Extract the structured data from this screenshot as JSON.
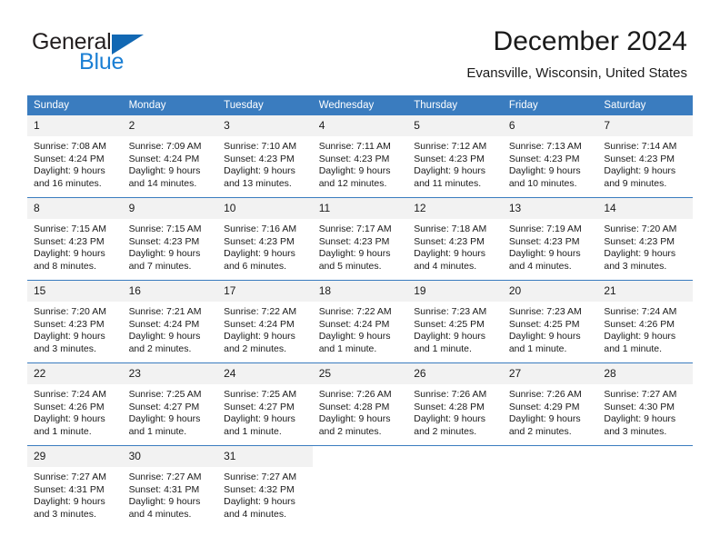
{
  "brand": {
    "logo_text_top": "General",
    "logo_text_bottom": "Blue",
    "logo_triangle_icon": "triangle-icon",
    "accent_color": "#3a7cbf",
    "logo_blue": "#1b7fd4"
  },
  "header": {
    "title": "December 2024",
    "subtitle": "Evansville, Wisconsin, United States"
  },
  "weekday_headers": [
    "Sunday",
    "Monday",
    "Tuesday",
    "Wednesday",
    "Thursday",
    "Friday",
    "Saturday"
  ],
  "weeks": [
    [
      {
        "day": "1",
        "sunrise": "Sunrise: 7:08 AM",
        "sunset": "Sunset: 4:24 PM",
        "daylight_1": "Daylight: 9 hours",
        "daylight_2": "and 16 minutes."
      },
      {
        "day": "2",
        "sunrise": "Sunrise: 7:09 AM",
        "sunset": "Sunset: 4:24 PM",
        "daylight_1": "Daylight: 9 hours",
        "daylight_2": "and 14 minutes."
      },
      {
        "day": "3",
        "sunrise": "Sunrise: 7:10 AM",
        "sunset": "Sunset: 4:23 PM",
        "daylight_1": "Daylight: 9 hours",
        "daylight_2": "and 13 minutes."
      },
      {
        "day": "4",
        "sunrise": "Sunrise: 7:11 AM",
        "sunset": "Sunset: 4:23 PM",
        "daylight_1": "Daylight: 9 hours",
        "daylight_2": "and 12 minutes."
      },
      {
        "day": "5",
        "sunrise": "Sunrise: 7:12 AM",
        "sunset": "Sunset: 4:23 PM",
        "daylight_1": "Daylight: 9 hours",
        "daylight_2": "and 11 minutes."
      },
      {
        "day": "6",
        "sunrise": "Sunrise: 7:13 AM",
        "sunset": "Sunset: 4:23 PM",
        "daylight_1": "Daylight: 9 hours",
        "daylight_2": "and 10 minutes."
      },
      {
        "day": "7",
        "sunrise": "Sunrise: 7:14 AM",
        "sunset": "Sunset: 4:23 PM",
        "daylight_1": "Daylight: 9 hours",
        "daylight_2": "and 9 minutes."
      }
    ],
    [
      {
        "day": "8",
        "sunrise": "Sunrise: 7:15 AM",
        "sunset": "Sunset: 4:23 PM",
        "daylight_1": "Daylight: 9 hours",
        "daylight_2": "and 8 minutes."
      },
      {
        "day": "9",
        "sunrise": "Sunrise: 7:15 AM",
        "sunset": "Sunset: 4:23 PM",
        "daylight_1": "Daylight: 9 hours",
        "daylight_2": "and 7 minutes."
      },
      {
        "day": "10",
        "sunrise": "Sunrise: 7:16 AM",
        "sunset": "Sunset: 4:23 PM",
        "daylight_1": "Daylight: 9 hours",
        "daylight_2": "and 6 minutes."
      },
      {
        "day": "11",
        "sunrise": "Sunrise: 7:17 AM",
        "sunset": "Sunset: 4:23 PM",
        "daylight_1": "Daylight: 9 hours",
        "daylight_2": "and 5 minutes."
      },
      {
        "day": "12",
        "sunrise": "Sunrise: 7:18 AM",
        "sunset": "Sunset: 4:23 PM",
        "daylight_1": "Daylight: 9 hours",
        "daylight_2": "and 4 minutes."
      },
      {
        "day": "13",
        "sunrise": "Sunrise: 7:19 AM",
        "sunset": "Sunset: 4:23 PM",
        "daylight_1": "Daylight: 9 hours",
        "daylight_2": "and 4 minutes."
      },
      {
        "day": "14",
        "sunrise": "Sunrise: 7:20 AM",
        "sunset": "Sunset: 4:23 PM",
        "daylight_1": "Daylight: 9 hours",
        "daylight_2": "and 3 minutes."
      }
    ],
    [
      {
        "day": "15",
        "sunrise": "Sunrise: 7:20 AM",
        "sunset": "Sunset: 4:23 PM",
        "daylight_1": "Daylight: 9 hours",
        "daylight_2": "and 3 minutes."
      },
      {
        "day": "16",
        "sunrise": "Sunrise: 7:21 AM",
        "sunset": "Sunset: 4:24 PM",
        "daylight_1": "Daylight: 9 hours",
        "daylight_2": "and 2 minutes."
      },
      {
        "day": "17",
        "sunrise": "Sunrise: 7:22 AM",
        "sunset": "Sunset: 4:24 PM",
        "daylight_1": "Daylight: 9 hours",
        "daylight_2": "and 2 minutes."
      },
      {
        "day": "18",
        "sunrise": "Sunrise: 7:22 AM",
        "sunset": "Sunset: 4:24 PM",
        "daylight_1": "Daylight: 9 hours",
        "daylight_2": "and 1 minute."
      },
      {
        "day": "19",
        "sunrise": "Sunrise: 7:23 AM",
        "sunset": "Sunset: 4:25 PM",
        "daylight_1": "Daylight: 9 hours",
        "daylight_2": "and 1 minute."
      },
      {
        "day": "20",
        "sunrise": "Sunrise: 7:23 AM",
        "sunset": "Sunset: 4:25 PM",
        "daylight_1": "Daylight: 9 hours",
        "daylight_2": "and 1 minute."
      },
      {
        "day": "21",
        "sunrise": "Sunrise: 7:24 AM",
        "sunset": "Sunset: 4:26 PM",
        "daylight_1": "Daylight: 9 hours",
        "daylight_2": "and 1 minute."
      }
    ],
    [
      {
        "day": "22",
        "sunrise": "Sunrise: 7:24 AM",
        "sunset": "Sunset: 4:26 PM",
        "daylight_1": "Daylight: 9 hours",
        "daylight_2": "and 1 minute."
      },
      {
        "day": "23",
        "sunrise": "Sunrise: 7:25 AM",
        "sunset": "Sunset: 4:27 PM",
        "daylight_1": "Daylight: 9 hours",
        "daylight_2": "and 1 minute."
      },
      {
        "day": "24",
        "sunrise": "Sunrise: 7:25 AM",
        "sunset": "Sunset: 4:27 PM",
        "daylight_1": "Daylight: 9 hours",
        "daylight_2": "and 1 minute."
      },
      {
        "day": "25",
        "sunrise": "Sunrise: 7:26 AM",
        "sunset": "Sunset: 4:28 PM",
        "daylight_1": "Daylight: 9 hours",
        "daylight_2": "and 2 minutes."
      },
      {
        "day": "26",
        "sunrise": "Sunrise: 7:26 AM",
        "sunset": "Sunset: 4:28 PM",
        "daylight_1": "Daylight: 9 hours",
        "daylight_2": "and 2 minutes."
      },
      {
        "day": "27",
        "sunrise": "Sunrise: 7:26 AM",
        "sunset": "Sunset: 4:29 PM",
        "daylight_1": "Daylight: 9 hours",
        "daylight_2": "and 2 minutes."
      },
      {
        "day": "28",
        "sunrise": "Sunrise: 7:27 AM",
        "sunset": "Sunset: 4:30 PM",
        "daylight_1": "Daylight: 9 hours",
        "daylight_2": "and 3 minutes."
      }
    ],
    [
      {
        "day": "29",
        "sunrise": "Sunrise: 7:27 AM",
        "sunset": "Sunset: 4:31 PM",
        "daylight_1": "Daylight: 9 hours",
        "daylight_2": "and 3 minutes."
      },
      {
        "day": "30",
        "sunrise": "Sunrise: 7:27 AM",
        "sunset": "Sunset: 4:31 PM",
        "daylight_1": "Daylight: 9 hours",
        "daylight_2": "and 4 minutes."
      },
      {
        "day": "31",
        "sunrise": "Sunrise: 7:27 AM",
        "sunset": "Sunset: 4:32 PM",
        "daylight_1": "Daylight: 9 hours",
        "daylight_2": "and 4 minutes."
      },
      {
        "day": "",
        "sunrise": "",
        "sunset": "",
        "daylight_1": "",
        "daylight_2": ""
      },
      {
        "day": "",
        "sunrise": "",
        "sunset": "",
        "daylight_1": "",
        "daylight_2": ""
      },
      {
        "day": "",
        "sunrise": "",
        "sunset": "",
        "daylight_1": "",
        "daylight_2": ""
      },
      {
        "day": "",
        "sunrise": "",
        "sunset": "",
        "daylight_1": "",
        "daylight_2": ""
      }
    ]
  ]
}
